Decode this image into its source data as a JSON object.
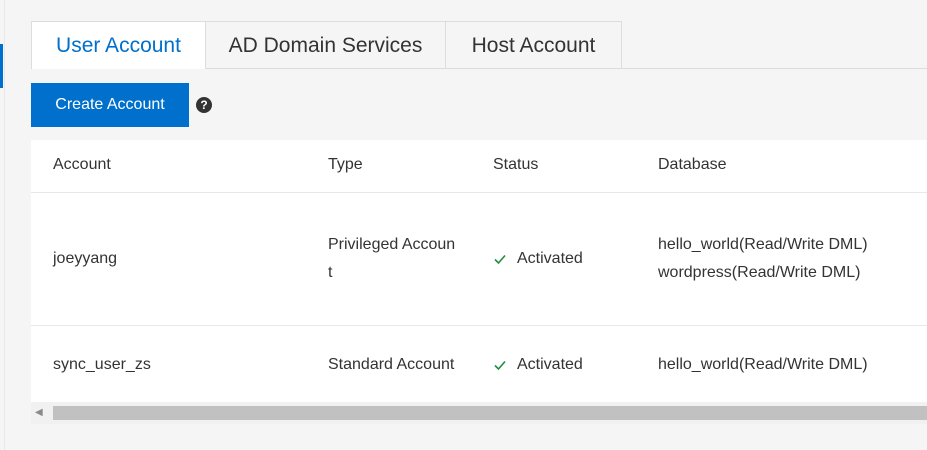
{
  "tabs": [
    {
      "label": "User Account",
      "active": true
    },
    {
      "label": "AD Domain Services",
      "active": false
    },
    {
      "label": "Host Account",
      "active": false
    }
  ],
  "toolbar": {
    "create_label": "Create Account",
    "help_glyph": "?"
  },
  "table": {
    "headers": {
      "account": "Account",
      "type": "Type",
      "status": "Status",
      "database": "Database"
    },
    "rows": [
      {
        "account": "joeyyang",
        "type": "Privileged Account",
        "status": "Activated",
        "databases": [
          "hello_world(Read/Write DML)",
          "wordpress(Read/Write DML)"
        ]
      },
      {
        "account": "sync_user_zs",
        "type": "Standard Account",
        "status": "Activated",
        "databases": [
          "hello_world(Read/Write DML)"
        ]
      }
    ]
  },
  "scrollbar": {
    "left_arrow": "◀"
  },
  "colors": {
    "accent": "#0070cc",
    "success": "#1e8e3e"
  }
}
